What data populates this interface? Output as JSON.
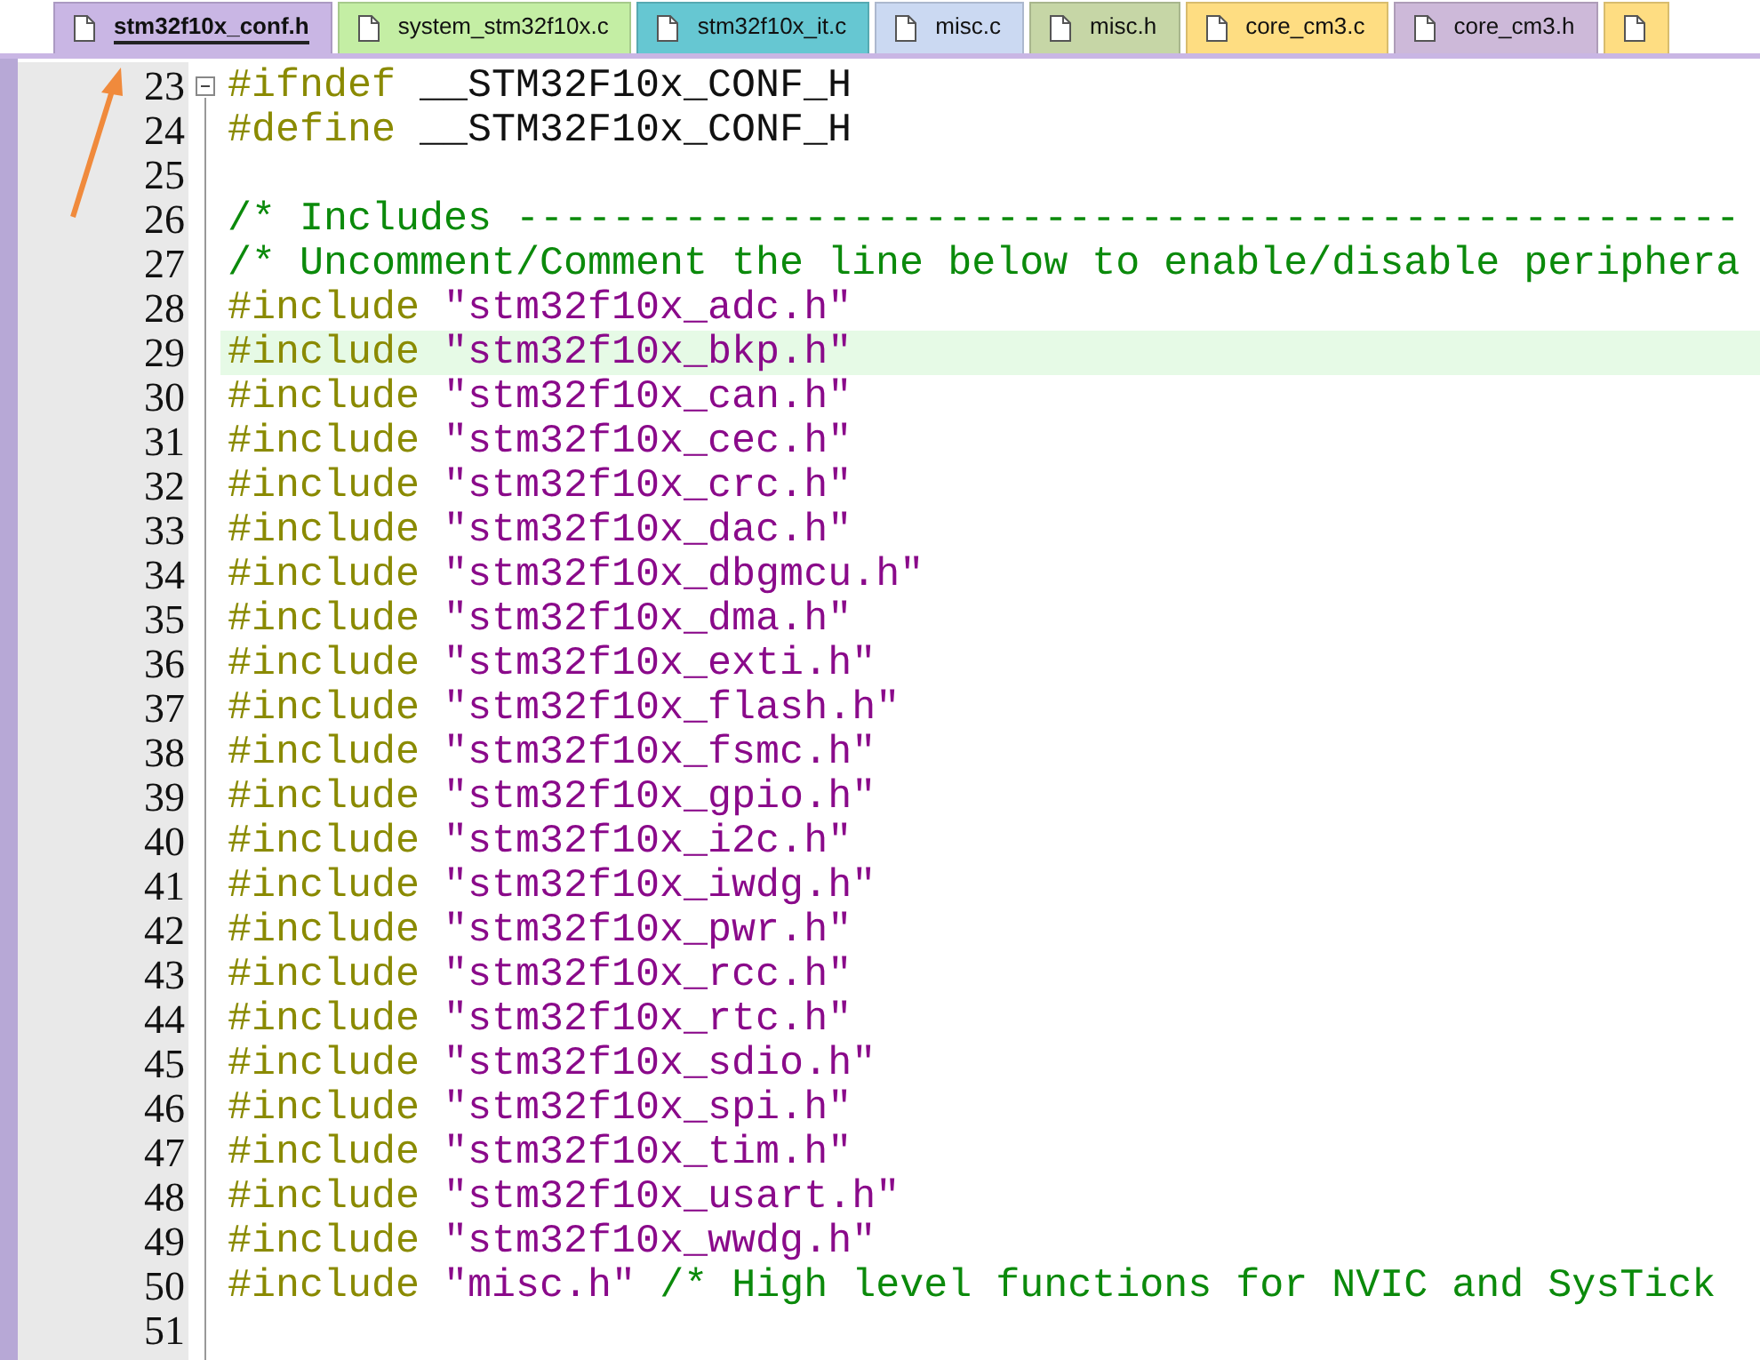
{
  "tabs": [
    {
      "label": "stm32f10x_conf.h",
      "selected": true,
      "color": "#c9b6e4"
    },
    {
      "label": "system_stm32f10x.c",
      "selected": false,
      "color": "#c4eea4"
    },
    {
      "label": "stm32f10x_it.c",
      "selected": false,
      "color": "#66c7d2"
    },
    {
      "label": "misc.c",
      "selected": false,
      "color": "#cbd9f2"
    },
    {
      "label": "misc.h",
      "selected": false,
      "color": "#c6d6a6"
    },
    {
      "label": "core_cm3.c",
      "selected": false,
      "color": "#fedd82"
    },
    {
      "label": "core_cm3.h",
      "selected": false,
      "color": "#cdb9d9"
    },
    {
      "selected": false,
      "color": "#fedd82"
    }
  ],
  "editor": {
    "lines": [
      {
        "number": "23",
        "fold": true,
        "current": false,
        "segments": [
          {
            "kind": "preprocessor",
            "text": "#ifndef"
          },
          {
            "kind": "plain",
            "text": " __STM32F10x_CONF_H"
          }
        ]
      },
      {
        "number": "24",
        "current": false,
        "segments": [
          {
            "kind": "preprocessor",
            "text": "#define"
          },
          {
            "kind": "plain",
            "text": " __STM32F10x_CONF_H"
          }
        ]
      },
      {
        "number": "25",
        "current": false
      },
      {
        "number": "26",
        "current": false,
        "segments": [
          {
            "kind": "comment",
            "text": "/* Includes ---------------------------------------------------"
          }
        ]
      },
      {
        "number": "27",
        "current": false,
        "segments": [
          {
            "kind": "comment",
            "text": "/* Uncomment/Comment the line below to enable/disable periphera"
          }
        ]
      },
      {
        "number": "28",
        "current": false,
        "segments": [
          {
            "kind": "preprocessor",
            "text": "#include "
          },
          {
            "kind": "string",
            "text": "\"stm32f10x_adc.h\""
          }
        ]
      },
      {
        "number": "29",
        "current": true,
        "segments": [
          {
            "kind": "preprocessor",
            "text": "#include "
          },
          {
            "kind": "string",
            "text": "\"stm32f10x_bkp.h\""
          }
        ]
      },
      {
        "number": "30",
        "current": false,
        "segments": [
          {
            "kind": "preprocessor",
            "text": "#include "
          },
          {
            "kind": "string",
            "text": "\"stm32f10x_can.h\""
          }
        ]
      },
      {
        "number": "31",
        "current": false,
        "segments": [
          {
            "kind": "preprocessor",
            "text": "#include "
          },
          {
            "kind": "string",
            "text": "\"stm32f10x_cec.h\""
          }
        ]
      },
      {
        "number": "32",
        "current": false,
        "segments": [
          {
            "kind": "preprocessor",
            "text": "#include "
          },
          {
            "kind": "string",
            "text": "\"stm32f10x_crc.h\""
          }
        ]
      },
      {
        "number": "33",
        "current": false,
        "segments": [
          {
            "kind": "preprocessor",
            "text": "#include "
          },
          {
            "kind": "string",
            "text": "\"stm32f10x_dac.h\""
          }
        ]
      },
      {
        "number": "34",
        "current": false,
        "segments": [
          {
            "kind": "preprocessor",
            "text": "#include "
          },
          {
            "kind": "string",
            "text": "\"stm32f10x_dbgmcu.h\""
          }
        ]
      },
      {
        "number": "35",
        "current": false,
        "segments": [
          {
            "kind": "preprocessor",
            "text": "#include "
          },
          {
            "kind": "string",
            "text": "\"stm32f10x_dma.h\""
          }
        ]
      },
      {
        "number": "36",
        "current": false,
        "segments": [
          {
            "kind": "preprocessor",
            "text": "#include "
          },
          {
            "kind": "string",
            "text": "\"stm32f10x_exti.h\""
          }
        ]
      },
      {
        "number": "37",
        "current": false,
        "segments": [
          {
            "kind": "preprocessor",
            "text": "#include "
          },
          {
            "kind": "string",
            "text": "\"stm32f10x_flash.h\""
          }
        ]
      },
      {
        "number": "38",
        "current": false,
        "segments": [
          {
            "kind": "preprocessor",
            "text": "#include "
          },
          {
            "kind": "string",
            "text": "\"stm32f10x_fsmc.h\""
          }
        ]
      },
      {
        "number": "39",
        "current": false,
        "segments": [
          {
            "kind": "preprocessor",
            "text": "#include "
          },
          {
            "kind": "string",
            "text": "\"stm32f10x_gpio.h\""
          }
        ]
      },
      {
        "number": "40",
        "current": false,
        "segments": [
          {
            "kind": "preprocessor",
            "text": "#include "
          },
          {
            "kind": "string",
            "text": "\"stm32f10x_i2c.h\""
          }
        ]
      },
      {
        "number": "41",
        "current": false,
        "segments": [
          {
            "kind": "preprocessor",
            "text": "#include "
          },
          {
            "kind": "string",
            "text": "\"stm32f10x_iwdg.h\""
          }
        ]
      },
      {
        "number": "42",
        "current": false,
        "segments": [
          {
            "kind": "preprocessor",
            "text": "#include "
          },
          {
            "kind": "string",
            "text": "\"stm32f10x_pwr.h\""
          }
        ]
      },
      {
        "number": "43",
        "current": false,
        "segments": [
          {
            "kind": "preprocessor",
            "text": "#include "
          },
          {
            "kind": "string",
            "text": "\"stm32f10x_rcc.h\""
          }
        ]
      },
      {
        "number": "44",
        "current": false,
        "segments": [
          {
            "kind": "preprocessor",
            "text": "#include "
          },
          {
            "kind": "string",
            "text": "\"stm32f10x_rtc.h\""
          }
        ]
      },
      {
        "number": "45",
        "current": false,
        "segments": [
          {
            "kind": "preprocessor",
            "text": "#include "
          },
          {
            "kind": "string",
            "text": "\"stm32f10x_sdio.h\""
          }
        ]
      },
      {
        "number": "46",
        "current": false,
        "segments": [
          {
            "kind": "preprocessor",
            "text": "#include "
          },
          {
            "kind": "string",
            "text": "\"stm32f10x_spi.h\""
          }
        ]
      },
      {
        "number": "47",
        "current": false,
        "segments": [
          {
            "kind": "preprocessor",
            "text": "#include "
          },
          {
            "kind": "string",
            "text": "\"stm32f10x_tim.h\""
          }
        ]
      },
      {
        "number": "48",
        "current": false,
        "segments": [
          {
            "kind": "preprocessor",
            "text": "#include "
          },
          {
            "kind": "string",
            "text": "\"stm32f10x_usart.h\""
          }
        ]
      },
      {
        "number": "49",
        "current": false,
        "segments": [
          {
            "kind": "preprocessor",
            "text": "#include "
          },
          {
            "kind": "string",
            "text": "\"stm32f10x_wwdg.h\""
          }
        ]
      },
      {
        "number": "50",
        "current": false,
        "segments": [
          {
            "kind": "preprocessor",
            "text": "#include "
          },
          {
            "kind": "string",
            "text": "\"misc.h\""
          },
          {
            "kind": "comment",
            "text": " /* High level functions for NVIC and SysTick"
          }
        ]
      },
      {
        "number": "51",
        "current": false
      }
    ]
  }
}
